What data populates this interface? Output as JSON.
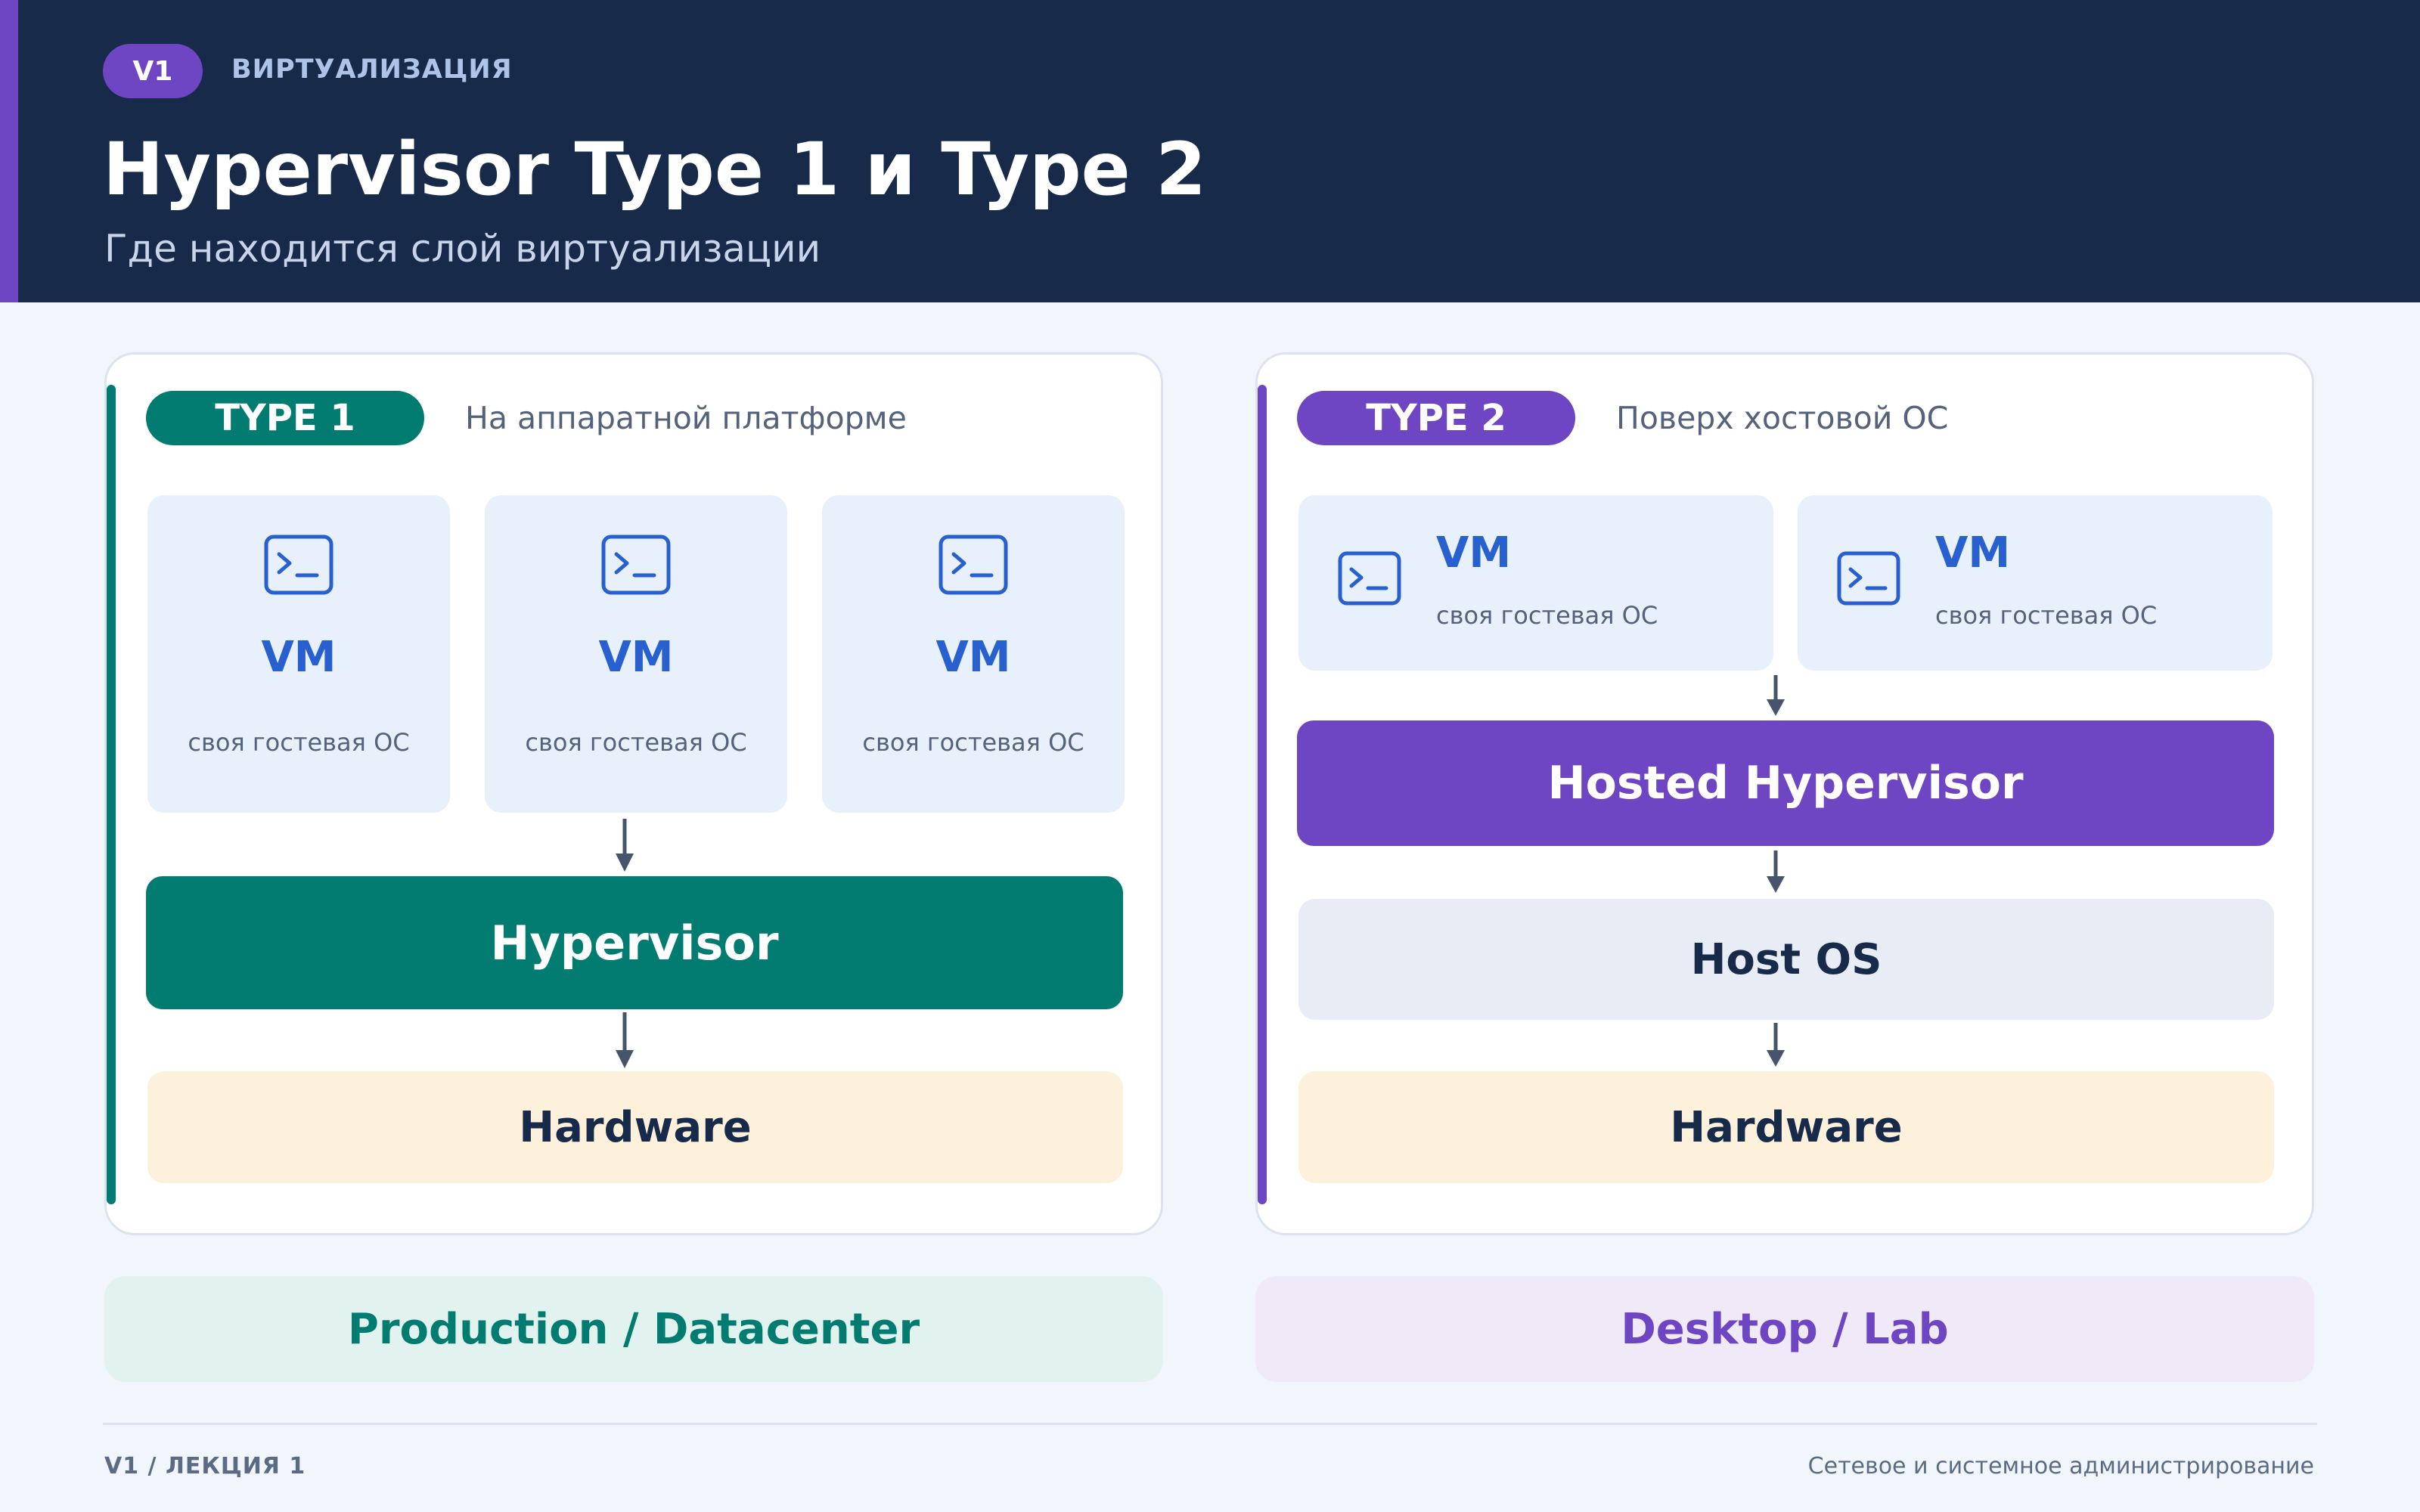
{
  "colors": {
    "header_bg": "#172a49",
    "accent_purple": "#6e45c2",
    "accent_teal": "#027c71",
    "vm_blue": "#2860cf",
    "vm_card_bg": "#e8f0fc",
    "hardware_bg": "#fef1dc",
    "host_os_bg": "#e8edf5",
    "page_bg": "#f1f5fc"
  },
  "header": {
    "badge": "V1",
    "kicker": "ВИРТУАЛИЗАЦИЯ",
    "title": "Hypervisor Type 1 и Type 2",
    "subtitle": "Где находится слой виртуализации"
  },
  "type1": {
    "pill": "TYPE 1",
    "description": "На аппаратной платформе",
    "vms": [
      {
        "label": "VM",
        "sub": "своя гостевая ОС",
        "icon": "terminal-icon"
      },
      {
        "label": "VM",
        "sub": "своя гостевая ОС",
        "icon": "terminal-icon"
      },
      {
        "label": "VM",
        "sub": "своя гостевая ОС",
        "icon": "terminal-icon"
      }
    ],
    "hypervisor": "Hypervisor",
    "hardware": "Hardware",
    "usage": "Production / Datacenter"
  },
  "type2": {
    "pill": "TYPE 2",
    "description": "Поверх хостовой ОС",
    "vms": [
      {
        "label": "VM",
        "sub": "своя гостевая ОС",
        "icon": "terminal-icon"
      },
      {
        "label": "VM",
        "sub": "своя гостевая ОС",
        "icon": "terminal-icon"
      }
    ],
    "hypervisor": "Hosted Hypervisor",
    "host_os": "Host OS",
    "hardware": "Hardware",
    "usage": "Desktop / Lab"
  },
  "footer": {
    "left": "V1 / ЛЕКЦИЯ 1",
    "right": "Сетевое и системное администрирование"
  }
}
